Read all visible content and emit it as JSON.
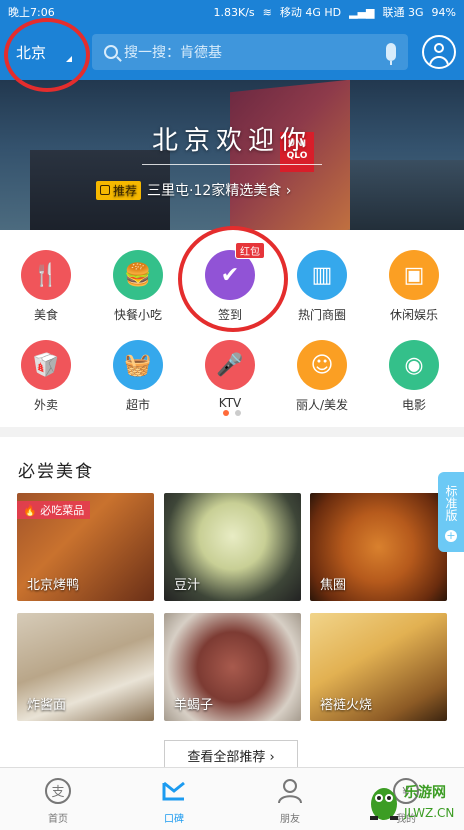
{
  "status_bar": {
    "time_text": "晚上7:06",
    "speed": "1.83K/s",
    "carrier1": "移动 4G HD",
    "carrier2": "联通 3G",
    "battery": "94%"
  },
  "header": {
    "city": "北京",
    "search_placeholder": "搜一搜：肯德基",
    "icons": [
      "search-icon",
      "mic-icon",
      "user-icon"
    ]
  },
  "banner": {
    "title": "北京欢迎你",
    "badge": "推荐",
    "subtitle": "三里屯·12家精选美食 ›",
    "sign_text": "UNIQLO"
  },
  "categories": [
    {
      "label": "美食",
      "color": "#f0555a",
      "icon": "fork-knife-icon",
      "glyph": "🍴"
    },
    {
      "label": "快餐小吃",
      "color": "#34c08a",
      "icon": "burger-icon",
      "glyph": "🍔"
    },
    {
      "label": "签到",
      "color": "#9153d6",
      "icon": "check-icon",
      "glyph": "✔",
      "tag": "红包"
    },
    {
      "label": "热门商圈",
      "color": "#35a8ec",
      "icon": "building-icon",
      "glyph": "▥"
    },
    {
      "label": "休闲娱乐",
      "color": "#fb9f23",
      "icon": "gamepad-icon",
      "glyph": "▣"
    },
    {
      "label": "外卖",
      "color": "#f0555a",
      "icon": "takeout-icon",
      "glyph": "🥡"
    },
    {
      "label": "超市",
      "color": "#35a8ec",
      "icon": "basket-icon",
      "glyph": "🧺"
    },
    {
      "label": "KTV",
      "color": "#f0555a",
      "icon": "microphone-icon",
      "glyph": "🎤"
    },
    {
      "label": "丽人/美发",
      "color": "#fb9f23",
      "icon": "hair-icon",
      "glyph": "☺"
    },
    {
      "label": "电影",
      "color": "#34c08a",
      "icon": "film-reel-icon",
      "glyph": "◉"
    }
  ],
  "pager": {
    "count": 2,
    "active": 0,
    "active_color": "#ff6a3a"
  },
  "must_eat": {
    "title": "必尝美食",
    "badge": "必吃菜品",
    "items": [
      {
        "name": "北京烤鸭",
        "bg": "linear-gradient(135deg,#a0532a 0%,#c9722e 40%,#6a2f17 100%)"
      },
      {
        "name": "豆汁",
        "bg": "radial-gradient(circle at 50% 40%,#e8ecc4 0%,#c8cf95 35%,#3e4638 70%,#222 100%)"
      },
      {
        "name": "焦圈",
        "bg": "radial-gradient(circle at 50% 50%,#d9812e 0%,#b65a1c 40%,#6a2c0e 80%,#2a1509 100%)"
      },
      {
        "name": "炸酱面",
        "bg": "linear-gradient(160deg,#d6cbb8 0%,#b9a689 45%,#e9e3d6 70%,#8a7356 100%)"
      },
      {
        "name": "羊蝎子",
        "bg": "radial-gradient(circle at 50% 50%,#a85a4d 0%,#7d3b33 40%,#d7cfc5 75%,#a59b8e 100%)"
      },
      {
        "name": "褡裢火烧",
        "bg": "linear-gradient(150deg,#f1d48a 0%,#e2b152 40%,#8c5a25 80%,#3b2410 100%)"
      }
    ],
    "view_all": "查看全部推荐 ›"
  },
  "side_tab": {
    "text": "标准版"
  },
  "tabbar": {
    "items": [
      {
        "label": "首页",
        "icon": "home-icon"
      },
      {
        "label": "口碑",
        "icon": "koubei-icon",
        "active": true
      },
      {
        "label": "朋友",
        "icon": "friends-icon"
      },
      {
        "label": "我的",
        "icon": "profile-icon"
      }
    ]
  },
  "watermark": {
    "text": "乐游网",
    "url": "JLWZ.CN"
  },
  "colors": {
    "primary": "#1c82d6",
    "highlight_ring": "#e42d2d",
    "tab_active": "#1c9bf0"
  }
}
